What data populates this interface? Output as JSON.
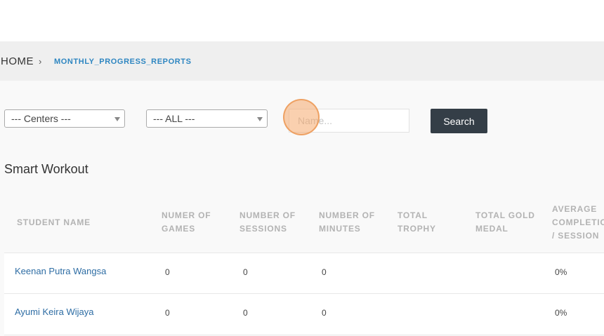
{
  "breadcrumb": {
    "home": "HOME",
    "separator": "›",
    "current": "MONTHLY_PROGRESS_REPORTS"
  },
  "filters": {
    "centers_selected": "--- Centers ---",
    "all_selected": "--- ALL ---",
    "name_placeholder": "Name...",
    "search_label": "Search"
  },
  "section": {
    "title": "Smart Workout"
  },
  "table": {
    "headers": [
      [
        "STUDENT NAME"
      ],
      [
        "NUMER OF",
        "GAMES"
      ],
      [
        "NUMBER OF",
        "SESSIONS"
      ],
      [
        "NUMBER OF",
        "MINUTES"
      ],
      [
        "TOTAL",
        "TROPHY"
      ],
      [
        "TOTAL GOLD",
        "MEDAL"
      ],
      [
        "AVERAGE",
        "COMPLETIO",
        "/ SESSION"
      ]
    ],
    "rows": [
      {
        "name": "Keenan Putra Wangsa",
        "games": "0",
        "sessions": "0",
        "minutes": "0",
        "trophy": "",
        "gold": "",
        "avg": "0%"
      },
      {
        "name": "Ayumi Keira Wijaya",
        "games": "0",
        "sessions": "0",
        "minutes": "0",
        "trophy": "",
        "gold": "",
        "avg": "0%"
      }
    ]
  },
  "colors": {
    "link": "#2e6da4",
    "breadcrumb_active": "#2e86c1",
    "button_bg": "#343e47",
    "header_text": "#b3b3b3"
  }
}
